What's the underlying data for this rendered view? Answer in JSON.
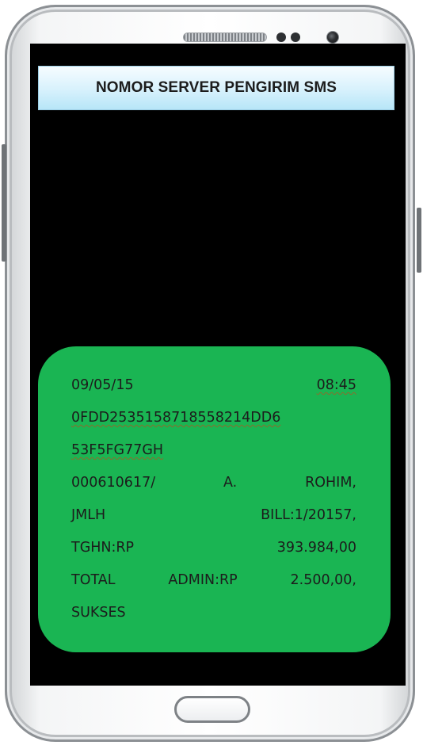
{
  "header": {
    "title": "NOMOR SERVER PENGIRIM SMS"
  },
  "sms": {
    "lines": [
      [
        "09/05/15",
        "08:45"
      ],
      [
        "0FDD2535158718558214DD6"
      ],
      [
        "53F5FG77GH"
      ],
      [
        "000610617/",
        "A.",
        "ROHIM,"
      ],
      [
        "JMLH",
        "BILL:1/20157,"
      ],
      [
        "TGHN:RP",
        "393.984,00"
      ],
      [
        "TOTAL",
        "ADMIN:RP",
        "2.500,00,"
      ],
      [
        "SUKSES"
      ]
    ]
  },
  "colors": {
    "screen_bg": "#000000",
    "header_bg": "#d7f1fc",
    "bubble_bg": "#1ab553"
  },
  "icons": {
    "home": "home-button-icon",
    "camera": "front-camera-icon",
    "speaker": "earpiece-speaker-icon"
  }
}
